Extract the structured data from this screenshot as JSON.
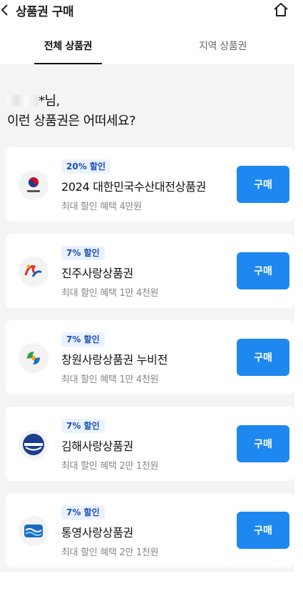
{
  "header": {
    "title": "상품권 구매"
  },
  "tabs": [
    {
      "label": "전체 상품권"
    },
    {
      "label": "지역 상품권"
    }
  ],
  "greeting": {
    "name_suffix": "*님,",
    "question": "이런 상품권은 어떠세요?"
  },
  "buy_label": "구매",
  "vouchers": [
    {
      "badge": "20% 할인",
      "name": "2024 대한민국수산대전상품권",
      "benefit": "최대 할인 혜택 4만원",
      "logo": "ministry-of-oceans-emblem"
    },
    {
      "badge": "7% 할인",
      "name": "진주사랑상품권",
      "benefit": "최대 할인 혜택 1만 4천원",
      "logo": "jinju-city-emblem"
    },
    {
      "badge": "7% 할인",
      "name": "창원사랑상품권 누비전",
      "benefit": "최대 할인 혜택 1만 4천원",
      "logo": "changwon-city-emblem"
    },
    {
      "badge": "7% 할인",
      "name": "김해사랑상품권",
      "benefit": "최대 할인 혜택 2만 1천원",
      "logo": "gimhae-city-emblem"
    },
    {
      "badge": "7% 할인",
      "name": "통영사랑상품권",
      "benefit": "최대 할인 혜택 2만 1천원",
      "logo": "tongyeong-city-emblem"
    }
  ],
  "colors": {
    "accent": "#1e87f0",
    "badge_bg": "#eaf1ff",
    "badge_text": "#1a4fb4"
  }
}
